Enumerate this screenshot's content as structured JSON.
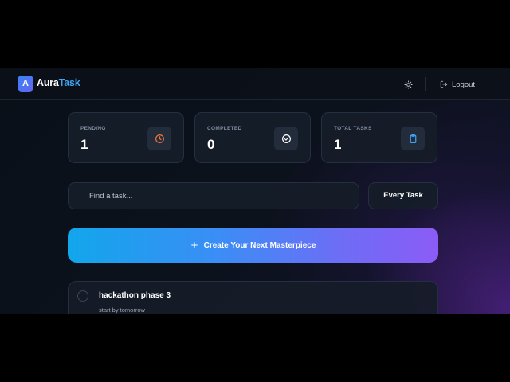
{
  "app": {
    "brand_part1": "Aura",
    "brand_part2": "Task",
    "logo_letter": "A"
  },
  "nav": {
    "logout_label": "Logout"
  },
  "stats": [
    {
      "label": "PENDING",
      "value": "1",
      "icon": "clock-icon",
      "icon_color": "#e5733a"
    },
    {
      "label": "COMPLETED",
      "value": "0",
      "icon": "check-circle-icon",
      "icon_color": "#ffffff"
    },
    {
      "label": "TOTAL TASKS",
      "value": "1",
      "icon": "clipboard-icon",
      "icon_color": "#3ea6f5"
    }
  ],
  "search": {
    "placeholder": "Find a task...",
    "value": ""
  },
  "filter": {
    "label": "Every Task"
  },
  "create": {
    "label": "Create Your Next Masterpiece"
  },
  "tasks": [
    {
      "title": "hackathon phase 3",
      "description": "start by tomorrow",
      "completed": false
    }
  ],
  "colors": {
    "accent_start": "#12a6ec",
    "accent_end": "#8b5cf6",
    "brand_accent": "#3ea6f5"
  }
}
